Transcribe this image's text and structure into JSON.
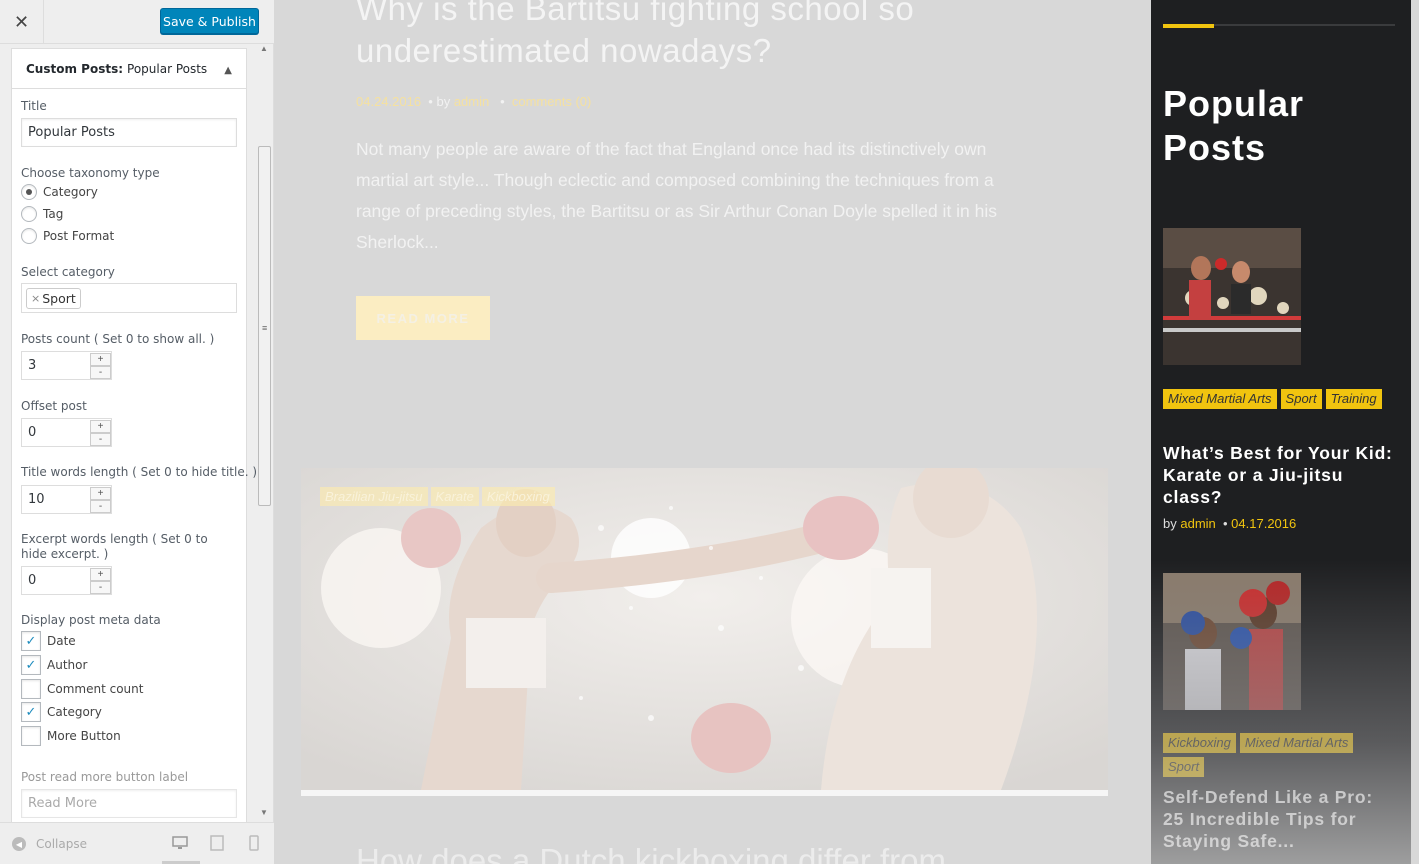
{
  "customizer": {
    "close_icon": "close-icon",
    "save_label": "Save & Publish",
    "section_prefix": "Custom Posts:",
    "section_name": "Popular Posts",
    "title_label": "Title",
    "title_value": "Popular Posts",
    "taxonomy_label": "Choose taxonomy type",
    "taxonomy_options": [
      "Category",
      "Tag",
      "Post Format"
    ],
    "taxonomy_selected": "Category",
    "category_label": "Select category",
    "category_tag": "Sport",
    "category_remove": "×",
    "posts_count_label": "Posts count ( Set 0 to show all. )",
    "posts_count_value": "3",
    "offset_label": "Offset post",
    "offset_value": "0",
    "title_words_label": "Title words length ( Set 0 to hide title. )",
    "title_words_value": "10",
    "excerpt_words_label": "Excerpt words length ( Set 0 to hide excerpt. )",
    "excerpt_words_value": "0",
    "meta_label": "Display post meta data",
    "meta_options": [
      {
        "label": "Date",
        "checked": true
      },
      {
        "label": "Author",
        "checked": true
      },
      {
        "label": "Comment count",
        "checked": false
      },
      {
        "label": "Category",
        "checked": true
      },
      {
        "label": "More Button",
        "checked": false
      }
    ],
    "read_more_label": "Post read more button label",
    "read_more_value": "Read More",
    "stepper_plus": "+",
    "stepper_minus": "-",
    "collapse_label": "Collapse"
  },
  "preview": {
    "post_title": "Why is the Bartitsu fighting school so underestimated nowadays?",
    "post_date": "04.24.2016",
    "post_by": "by",
    "post_author": "admin",
    "post_comments": "comments (0)",
    "post_excerpt": "Not many people are aware of the fact that England once had its distinctively own martial art style... Though eclectic and composed combining the techniques from a range of preceding styles, the Bartitsu or as Sir Arthur Conan Doyle spelled it in his Sherlock...",
    "read_more": "READ MORE",
    "feature_tags": [
      "Brazilian Jiu-jitsu",
      "Karate",
      "Kickboxing"
    ],
    "next_title": "How does a Dutch kickboxing differ from"
  },
  "sidebar": {
    "title": "Popular Posts",
    "posts": [
      {
        "cats": [
          "Mixed Martial Arts",
          "Sport",
          "Training"
        ],
        "title": "What’s Best for Your Kid: Karate or a Jiu-jitsu class?",
        "by": "by",
        "author": "admin",
        "date": "04.17.2016"
      },
      {
        "cats": [
          "Kickboxing",
          "Mixed Martial Arts",
          "Sport"
        ],
        "title": "Self-Defend Like a Pro: 25 Incredible Tips for Staying Safe..."
      }
    ]
  },
  "colors": {
    "accent": "#f1c40f",
    "primary_button": "#0085ba",
    "sidebar_bg": "#1e1f21"
  }
}
